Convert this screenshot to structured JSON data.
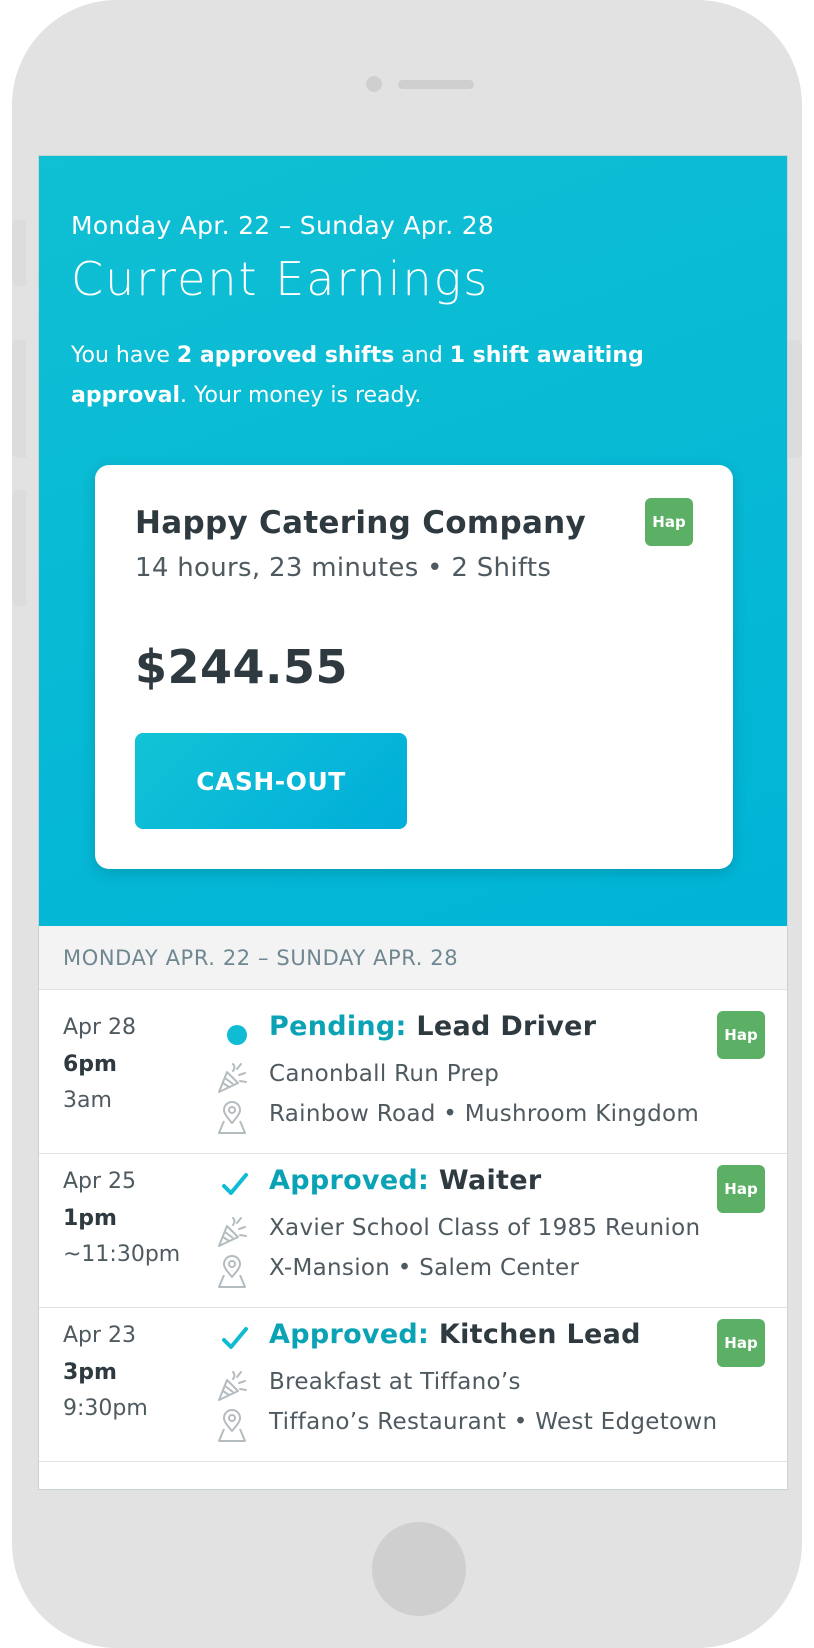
{
  "hero": {
    "week_range": "Monday Apr. 22 – Sunday Apr. 28",
    "title": "Current Earnings",
    "summary": {
      "part1": "You have ",
      "approved": "2 approved shifts",
      "part2": " and ",
      "awaiting": "1 shift awaiting approval",
      "part3": ". Your money is ready."
    }
  },
  "card": {
    "company": "Happy Catering Company",
    "badge": "Hap",
    "meta": "14 hours, 23 minutes • 2 Shifts",
    "amount": "$244.55",
    "cashout_label": "CASH-OUT"
  },
  "section_header": "MONDAY APR. 22 – SUNDAY APR. 28",
  "shifts": [
    {
      "date": "Apr 28",
      "start": "6pm",
      "end": "3am",
      "status": "Pending:",
      "status_icon": "pending-dot-icon",
      "role": "Lead Driver",
      "event": "Canonball Run Prep",
      "location": "Rainbow Road • Mushroom Kingdom",
      "badge": "Hap"
    },
    {
      "date": "Apr 25",
      "start": "1pm",
      "end": "~11:30pm",
      "status": "Approved:",
      "status_icon": "check-icon",
      "role": "Waiter",
      "event": "Xavier School Class of 1985 Reunion",
      "location": "X-Mansion • Salem Center",
      "badge": "Hap"
    },
    {
      "date": "Apr 23",
      "start": "3pm",
      "end": "9:30pm",
      "status": "Approved:",
      "status_icon": "check-icon",
      "role": "Kitchen Lead",
      "event": "Breakfast at Tiffano’s",
      "location": "Tiffano’s Restaurant • West Edgetown",
      "badge": "Hap"
    }
  ],
  "colors": {
    "accent": "#00b8d4",
    "status_text": "#0aa3b5",
    "badge_green": "#5cb065",
    "text_dark": "#2e3a40"
  }
}
